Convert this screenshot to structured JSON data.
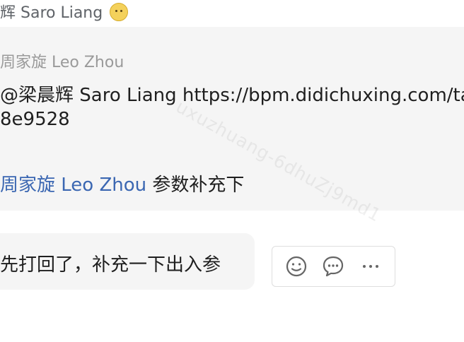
{
  "header": {
    "partial_name": "辉 Saro Liang",
    "reaction_icon": "duck-sticker-icon"
  },
  "quoted_message": {
    "author": "周家旋 Leo Zhou",
    "line1": "@梁晨辉 Saro Liang https://bpm.didichuxing.com/ta",
    "line2": "8e9528",
    "mention_name": "周家旋 Leo Zhou",
    "line4_suffix": " 参数补充下"
  },
  "reply": {
    "text": "先打回了，补充一下出入参"
  },
  "watermark": {
    "text": "uxuzhuang-6dhuZj9md1"
  },
  "actions": {
    "emoji_icon": "smile-icon",
    "reply_icon": "speech-bubble-icon",
    "more_icon": "more-horizontal-icon"
  },
  "colors": {
    "mention": "#3b67b2",
    "card_bg": "#f5f5f5",
    "muted": "#9a9a9a"
  }
}
